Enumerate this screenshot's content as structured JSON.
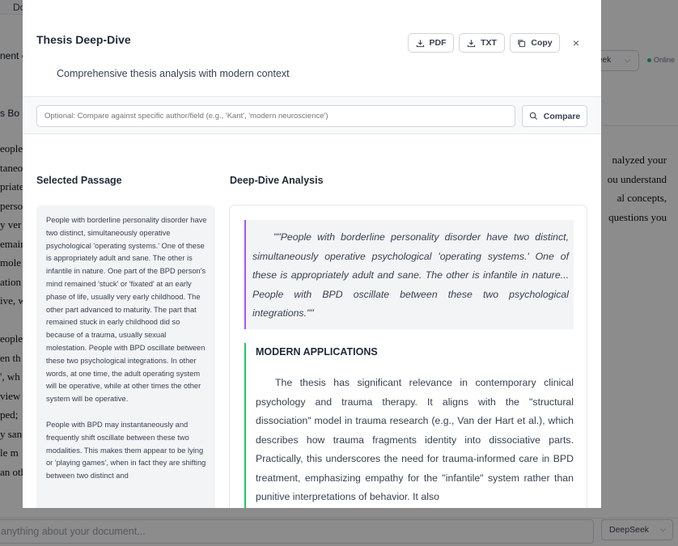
{
  "background": {
    "tab_label": "Do",
    "side_labels": [
      "nent c",
      "s Bo"
    ],
    "doc_fragments": [
      "eople",
      "taneo",
      "priate",
      "perso",
      "y ver",
      "emain",
      "mole",
      "ation",
      "ive, w",
      "",
      "eople",
      "en th",
      "', wh",
      "view",
      "ped; ",
      "y san",
      "le m",
      "an oth"
    ],
    "right_fragments": [
      "nalyzed your",
      "ou understand",
      "al concepts,",
      "questions you"
    ],
    "model_select_label": "eek",
    "status_label": "Online",
    "chat_placeholder": "anything about your document...",
    "chat_model_label": "DeepSeek"
  },
  "modal": {
    "title": "Thesis Deep-Dive",
    "subtitle": "Comprehensive thesis analysis with modern context",
    "buttons": {
      "pdf": "PDF",
      "txt": "TXT",
      "copy": "Copy",
      "close": "×"
    },
    "compare": {
      "placeholder": "Optional: Compare against specific author/field (e.g., 'Kant', 'modern neuroscience')",
      "button_label": "Compare"
    },
    "selected_passage": {
      "heading": "Selected Passage",
      "paragraphs": [
        "People with borderline personality disorder have two distinct, simultaneously operative psychological 'operating systems.' One of these is appropriately adult and sane. The other is infantile in nature. One part of the BPD person's mind remained 'stuck' or 'fixated' at an early phase of life, usually very early childhood. The other part advanced to maturity. The part that remained stuck in early childhood did so because of a trauma, usually sexual molestation. People with BPD oscillate between these two psychological integrations. In other words, at one time, the adult operating system will be operative, while at other times the other system will be operative.",
        "People with BPD may instantaneously and frequently shift oscillate between these two modalities. This makes them appear to be lying or 'playing games', when in fact they are shifting between two distinct and"
      ]
    },
    "analysis": {
      "heading": "Deep-Dive Analysis",
      "quote": "\"\"People with borderline personality disorder have two distinct, simultaneously operative psychological 'operating systems.' One of these is appropriately adult and sane. The other is infantile in nature... People with BPD oscillate between these two psychological integrations.\"\"",
      "modern_heading": "MODERN APPLICATIONS",
      "modern_text": "The thesis has significant relevance in contemporary clinical psychology and trauma therapy. It aligns with the \"structural dissociation\" model in trauma research (e.g., Van der Hart et al.), which describes how trauma fragments identity into dissociative parts. Practically, this underscores the need for trauma-informed care in BPD treatment, emphasizing empathy for the \"infantile\" system rather than punitive interpretations of behavior. It also"
    }
  }
}
